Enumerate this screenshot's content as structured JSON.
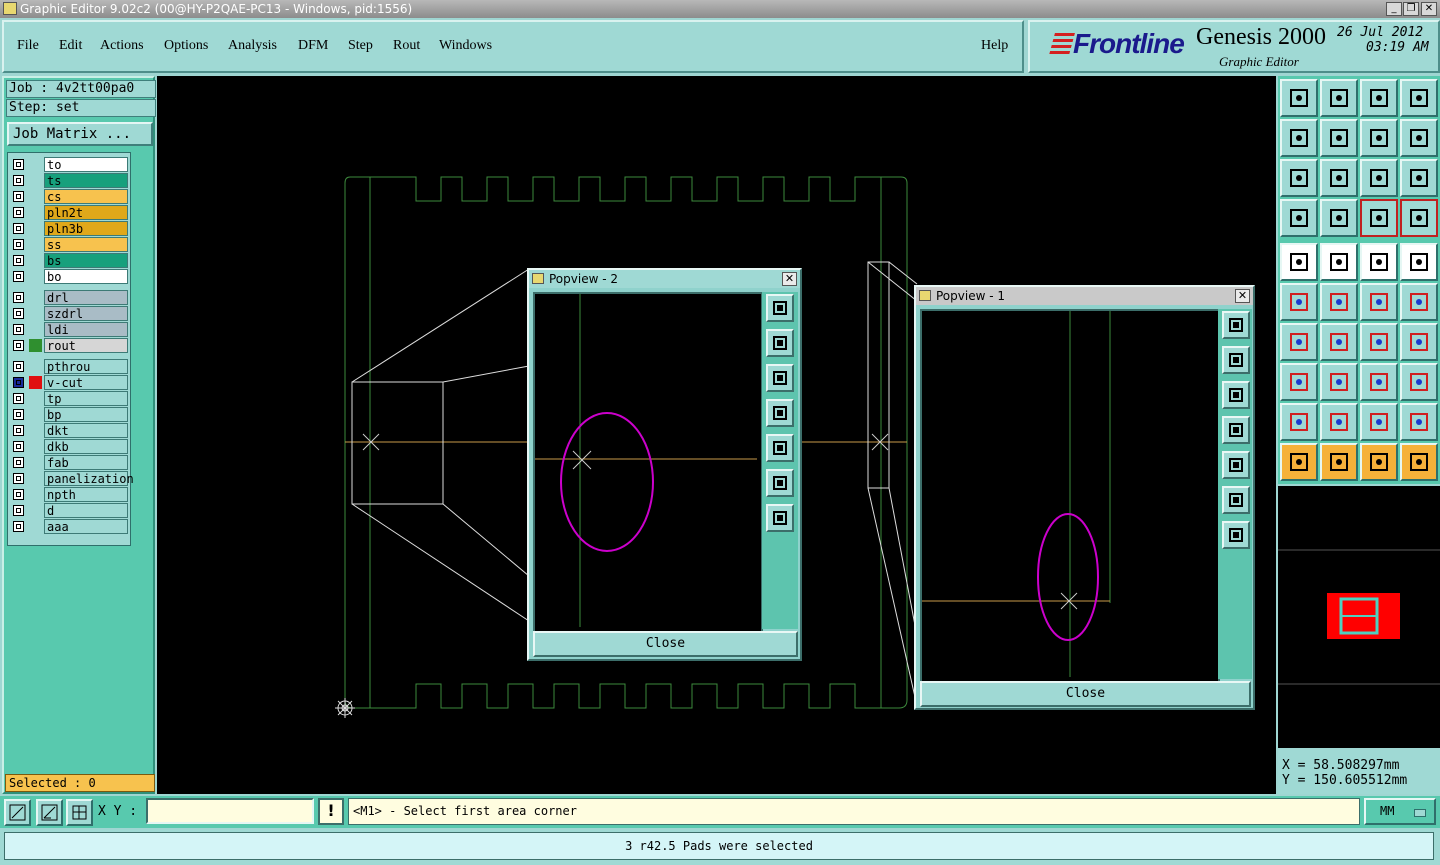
{
  "window": {
    "title": "Graphic Editor 9.02c2 (00@HY-P2QAE-PC13 - Windows, pid:1556)"
  },
  "menu": {
    "file": "File",
    "edit": "Edit",
    "actions": "Actions",
    "options": "Options",
    "analysis": "Analysis",
    "dfm": "DFM",
    "step": "Step",
    "rout": "Rout",
    "windows": "Windows",
    "help": "Help"
  },
  "brand": {
    "logo": "Frontline",
    "product": "Genesis 2000",
    "subtitle": "Graphic Editor",
    "date": "26 Jul 2012",
    "time": "03:19 AM"
  },
  "job": {
    "job_line": "Job : 4v2tt00pa0",
    "step_line": "Step: set",
    "matrix_button": "Job Matrix ..."
  },
  "layers": [
    {
      "name": "to",
      "color": "#ffffff"
    },
    {
      "name": "ts",
      "color": "#17a07c"
    },
    {
      "name": "cs",
      "color": "#f7c24e"
    },
    {
      "name": "pln2t",
      "color": "#e0a81a"
    },
    {
      "name": "pln3b",
      "color": "#e0a81a"
    },
    {
      "name": "ss",
      "color": "#f7c24e"
    },
    {
      "name": "bs",
      "color": "#17a07c"
    },
    {
      "name": "bo",
      "color": "#ffffff"
    },
    {
      "name": "drl",
      "color": "#a9bcc6"
    },
    {
      "name": "szdrl",
      "color": "#a9bcc6"
    },
    {
      "name": "ldi",
      "color": "#a9bcc6"
    },
    {
      "name": "rout",
      "color": "#d6d6d6"
    },
    {
      "name": "pthrou",
      "color": "#9fd9d4"
    },
    {
      "name": "v-cut",
      "color": "#9fd9d4"
    },
    {
      "name": "tp",
      "color": "#9fd9d4"
    },
    {
      "name": "bp",
      "color": "#9fd9d4"
    },
    {
      "name": "dkt",
      "color": "#9fd9d4"
    },
    {
      "name": "dkb",
      "color": "#9fd9d4"
    },
    {
      "name": "fab",
      "color": "#9fd9d4"
    },
    {
      "name": "panelization",
      "color": "#9fd9d4"
    },
    {
      "name": "npth",
      "color": "#9fd9d4"
    },
    {
      "name": "d",
      "color": "#9fd9d4"
    },
    {
      "name": "aaa",
      "color": "#9fd9d4"
    }
  ],
  "selected_text": "Selected : 0",
  "popview2": {
    "title": "Popview - 2",
    "close": "Close"
  },
  "popview1": {
    "title": "Popview - 1",
    "close": "Close"
  },
  "coords": {
    "x": "X  =  58.508297mm",
    "y": "Y  = 150.605512mm"
  },
  "bottom": {
    "xy_label": "X Y :",
    "xy_value": "",
    "warn": "!",
    "prompt": "<M1> - Select first area corner",
    "units": "MM"
  },
  "status": "3 r42.5 Pads were selected",
  "colors": {
    "panel": "#58c9ae",
    "light": "#9fd9d4",
    "profile": "#3d8a3d",
    "highlight": "#cc00cc",
    "vcut": "#c89a4a"
  }
}
